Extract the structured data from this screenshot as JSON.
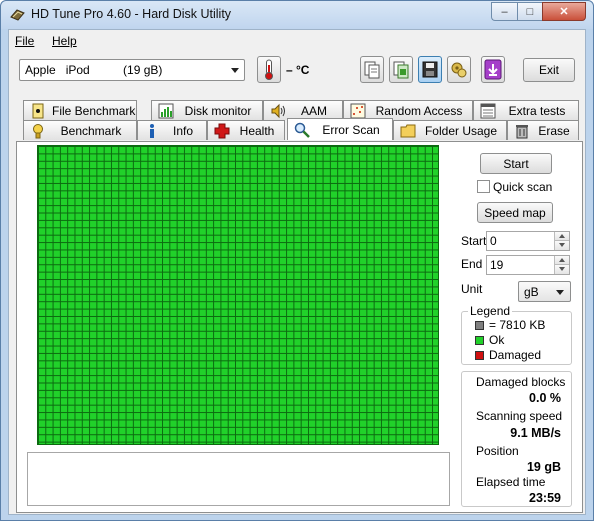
{
  "window": {
    "title": "HD Tune Pro 4.60 - Hard Disk Utility",
    "min_symbol": "–",
    "max_symbol": "□",
    "close_symbol": "✕"
  },
  "menu": {
    "file": "File",
    "help": "Help"
  },
  "toolbar": {
    "drive": "Apple   iPod          (19 gB)",
    "temperature": "– °C",
    "exit_label": "Exit",
    "icons": [
      "copy-text-icon",
      "copy-screenshot-icon",
      "save-icon",
      "options-icon",
      "download-icon"
    ]
  },
  "tabs": {
    "top_row": [
      {
        "label": "File Benchmark",
        "icon": "file-benchmark-icon"
      },
      {
        "label": "Disk monitor",
        "icon": "disk-monitor-icon"
      },
      {
        "label": "AAM",
        "icon": "speaker-icon"
      },
      {
        "label": "Random Access",
        "icon": "random-access-icon"
      },
      {
        "label": "Extra tests",
        "icon": "extra-tests-icon"
      }
    ],
    "bottom_row": [
      {
        "label": "Benchmark",
        "icon": "benchmark-icon"
      },
      {
        "label": "Info",
        "icon": "info-icon"
      },
      {
        "label": "Health",
        "icon": "health-icon"
      },
      {
        "label": "Error Scan",
        "icon": "magnifier-icon",
        "active": true
      },
      {
        "label": "Folder Usage",
        "icon": "folder-icon"
      },
      {
        "label": "Erase",
        "icon": "trash-icon"
      }
    ]
  },
  "error_scan": {
    "start_button": "Start",
    "quick_scan_label": "Quick scan",
    "quick_scan_checked": false,
    "speed_map_button": "Speed map",
    "start_label": "Start",
    "start_value": "0",
    "end_label": "End",
    "end_value": "19",
    "unit_label": "Unit",
    "unit_value": "gB",
    "scan_block_color": "#21d12a"
  },
  "legend": {
    "title": "Legend",
    "block_size": "= 7810 KB",
    "ok": "Ok",
    "damaged": "Damaged",
    "colors": {
      "block": "#808080",
      "ok": "#21d12a",
      "damaged": "#d01010"
    }
  },
  "stats": {
    "damaged_blocks_label": "Damaged blocks",
    "damaged_blocks_value": "0.0 %",
    "scanning_speed_label": "Scanning speed",
    "scanning_speed_value": "9.1 MB/s",
    "position_label": "Position",
    "position_value": "19 gB",
    "elapsed_label": "Elapsed time",
    "elapsed_value": "23:59"
  }
}
